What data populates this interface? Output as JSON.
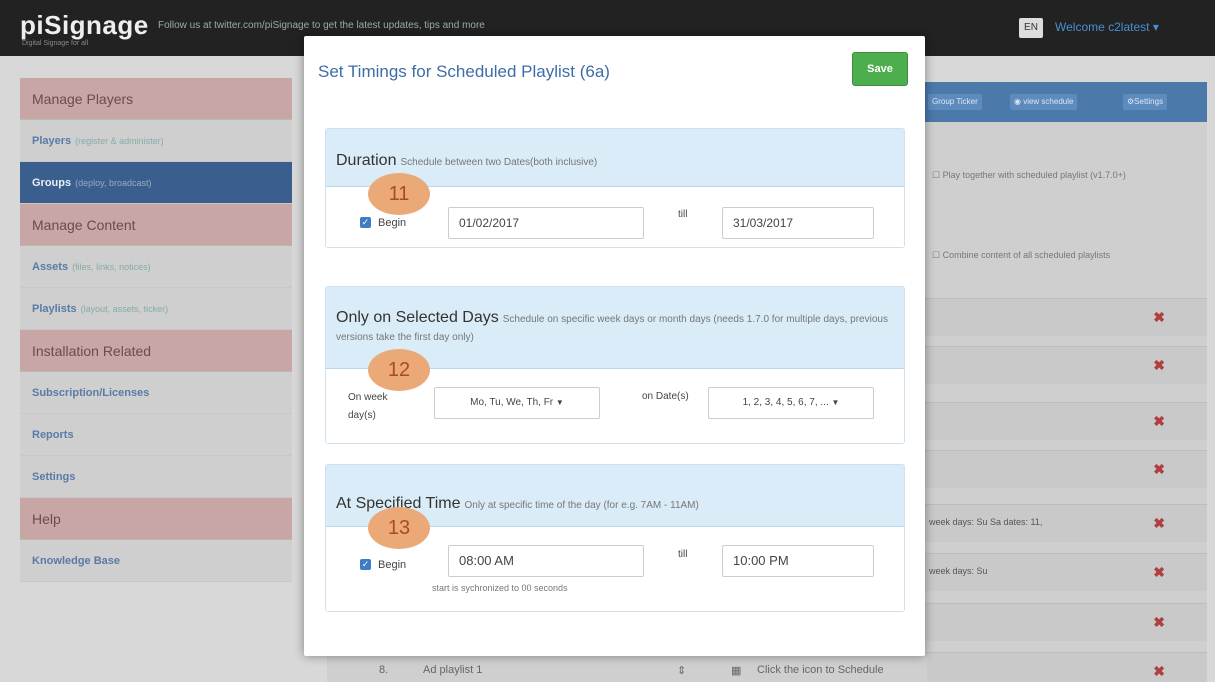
{
  "topbar": {
    "brand": "piSignage",
    "brand_tag": "Digital Signage for all",
    "message": "Follow us at twitter.com/piSignage to get the latest updates, tips and more",
    "lang": "EN",
    "welcome": "Welcome c2latest ▾"
  },
  "sidebar": {
    "items": [
      {
        "label": "Manage Players",
        "type": "head"
      },
      {
        "label": "Players",
        "hint": "(register & administer)"
      },
      {
        "label": "Groups",
        "hint": "(deploy, broadcast)",
        "active": true
      },
      {
        "label": "Manage Content",
        "type": "head"
      },
      {
        "label": "Assets",
        "hint": "(files, links, notices)"
      },
      {
        "label": "Playlists",
        "hint": "(layout, assets, ticker)"
      },
      {
        "label": "Installation Related",
        "type": "head"
      },
      {
        "label": "Subscription/Licenses",
        "hint": ""
      },
      {
        "label": "Reports",
        "hint": ""
      },
      {
        "label": "Settings",
        "hint": ""
      },
      {
        "label": "Help",
        "type": "head"
      },
      {
        "label": "Knowledge Base",
        "hint": ""
      }
    ]
  },
  "background": {
    "buttons": [
      "Group Ticker",
      "view schedule",
      "Settings"
    ],
    "option1": "Play together with scheduled playlist (v1.7.0+)",
    "option2": "Combine content of all scheduled playlists",
    "row5_text": "week days: Su Sa dates: 11,",
    "row6_text": "week days: Su",
    "bottom_num": "8.",
    "bottom_playlist": "Ad playlist 1",
    "bottom_hint": "Click the icon to Schedule"
  },
  "modal": {
    "title": "Set Timings for Scheduled Playlist (6a)",
    "save_label": "Save",
    "duration": {
      "title": "Duration",
      "subtitle": "Schedule between two Dates(both inclusive)",
      "badge": "11",
      "begin_label": "Begin",
      "start_date": "01/02/2017",
      "till_label": "till",
      "end_date": "31/03/2017"
    },
    "days": {
      "title": "Only on Selected Days",
      "subtitle": "Schedule on specific week days or month days (needs 1.7.0 for multiple days, previous versions take the first day only)",
      "badge": "12",
      "weekday_label": "On week day(s)",
      "weekday_value": "Mo, Tu, We, Th, Fr",
      "date_label": "on Date(s)",
      "date_value": "1, 2, 3, 4, 5, 6, 7, ..."
    },
    "time": {
      "title": "At Specified Time",
      "subtitle": "Only at specific time of the day (for e.g. 7AM - 11AM)",
      "badge": "13",
      "begin_label": "Begin",
      "start_time": "08:00 AM",
      "till_label": "till",
      "end_time": "10:00 PM",
      "note": "start is sychronized to 00 seconds"
    }
  },
  "colors": {
    "accent": "#3d6da8",
    "save": "#4cae4c",
    "badge": "#eba978",
    "section_head": "#d9ecf7"
  }
}
